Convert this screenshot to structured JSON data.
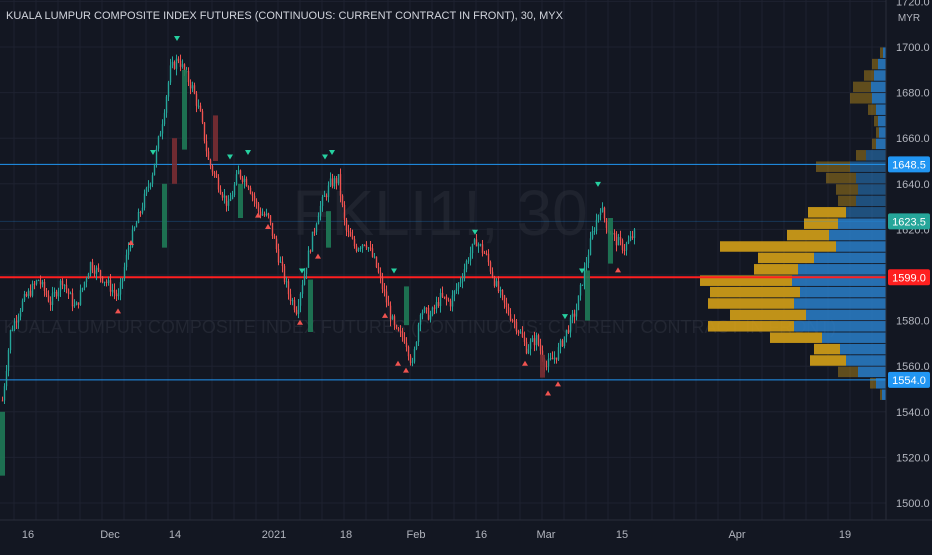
{
  "header": {
    "title": "KUALA LUMPUR COMPOSITE INDEX FUTURES (CONTINUOUS: CURRENT CONTRACT IN FRONT), 30, MYX"
  },
  "watermark": {
    "symbol": "FKLI1!, 30",
    "description": "KUALA LUMPUR COMPOSITE INDEX FUTURES (CONTINUOUS: CURRENT CONTRACT IN FRONT)"
  },
  "colors": {
    "background": "#131722",
    "grid": "#1e2230",
    "up": "#26a69a",
    "down": "#ef5350",
    "vol_up": "#2a7fc9",
    "vol_down": "#d4a017",
    "hline_blue": "#2196f3",
    "hline_red": "#ff1f1f",
    "badge_teal": "#26a69a",
    "text": "#b2b5be"
  },
  "chart_data": {
    "type": "candlestick",
    "currency": "MYR",
    "ylim": [
      1495,
      1720
    ],
    "y_ticks": [
      1500,
      1520,
      1540,
      1560,
      1580,
      1600,
      1620,
      1640,
      1660,
      1680,
      1700,
      1720
    ],
    "x_ticks": [
      {
        "label": "16",
        "pos": 28
      },
      {
        "label": "Dec",
        "pos": 110
      },
      {
        "label": "14",
        "pos": 175
      },
      {
        "label": "2021",
        "pos": 274
      },
      {
        "label": "18",
        "pos": 346
      },
      {
        "label": "Feb",
        "pos": 416
      },
      {
        "label": "16",
        "pos": 481
      },
      {
        "label": "Mar",
        "pos": 546
      },
      {
        "label": "15",
        "pos": 622
      },
      {
        "label": "Apr",
        "pos": 737
      },
      {
        "label": "19",
        "pos": 845
      }
    ],
    "price_path": [
      [
        2,
        1545
      ],
      [
        10,
        1575
      ],
      [
        22,
        1588
      ],
      [
        38,
        1598
      ],
      [
        50,
        1588
      ],
      [
        62,
        1598
      ],
      [
        75,
        1585
      ],
      [
        90,
        1605
      ],
      [
        104,
        1598
      ],
      [
        118,
        1590
      ],
      [
        128,
        1612
      ],
      [
        140,
        1628
      ],
      [
        152,
        1645
      ],
      [
        162,
        1668
      ],
      [
        170,
        1690
      ],
      [
        178,
        1695
      ],
      [
        185,
        1688
      ],
      [
        192,
        1682
      ],
      [
        200,
        1670
      ],
      [
        208,
        1650
      ],
      [
        218,
        1640
      ],
      [
        228,
        1630
      ],
      [
        238,
        1645
      ],
      [
        248,
        1640
      ],
      [
        258,
        1628
      ],
      [
        268,
        1625
      ],
      [
        278,
        1608
      ],
      [
        288,
        1592
      ],
      [
        296,
        1585
      ],
      [
        306,
        1605
      ],
      [
        318,
        1628
      ],
      [
        330,
        1640
      ],
      [
        338,
        1642
      ],
      [
        345,
        1620
      ],
      [
        355,
        1612
      ],
      [
        365,
        1615
      ],
      [
        375,
        1605
      ],
      [
        385,
        1590
      ],
      [
        395,
        1575
      ],
      [
        405,
        1572
      ],
      [
        412,
        1560
      ],
      [
        420,
        1585
      ],
      [
        430,
        1582
      ],
      [
        440,
        1590
      ],
      [
        450,
        1588
      ],
      [
        460,
        1598
      ],
      [
        468,
        1608
      ],
      [
        476,
        1615
      ],
      [
        486,
        1608
      ],
      [
        496,
        1595
      ],
      [
        506,
        1585
      ],
      [
        516,
        1578
      ],
      [
        526,
        1568
      ],
      [
        536,
        1572
      ],
      [
        546,
        1560
      ],
      [
        556,
        1565
      ],
      [
        566,
        1575
      ],
      [
        576,
        1585
      ],
      [
        584,
        1602
      ],
      [
        592,
        1618
      ],
      [
        600,
        1630
      ],
      [
        608,
        1620
      ],
      [
        616,
        1615
      ],
      [
        624,
        1612
      ],
      [
        634,
        1618
      ]
    ],
    "horizontal_lines": [
      {
        "price": 1648.5,
        "label": "1648.5",
        "color": "#2196f3",
        "badge": "#2196f3",
        "width": 1
      },
      {
        "price": 1623.5,
        "label": "1623.5",
        "color": "#2196f3",
        "badge": "#26a69a",
        "width": 0,
        "faint": true
      },
      {
        "price": 1599.0,
        "label": "1599.0",
        "color": "#ff1f1f",
        "badge": "#ff1f1f",
        "width": 2
      },
      {
        "price": 1554.0,
        "label": "1554.0",
        "color": "#2196f3",
        "badge": "#2196f3",
        "width": 1
      }
    ],
    "signals_up": [
      [
        118,
        1588
      ],
      [
        131,
        1618
      ],
      [
        258,
        1630
      ],
      [
        268,
        1625
      ],
      [
        300,
        1583
      ],
      [
        318,
        1612
      ],
      [
        385,
        1586
      ],
      [
        398,
        1565
      ],
      [
        406,
        1562
      ],
      [
        525,
        1565
      ],
      [
        548,
        1552
      ],
      [
        558,
        1556
      ],
      [
        618,
        1606
      ]
    ],
    "signals_down": [
      [
        153,
        1650
      ],
      [
        177,
        1700
      ],
      [
        230,
        1648
      ],
      [
        248,
        1650
      ],
      [
        302,
        1598
      ],
      [
        325,
        1648
      ],
      [
        332,
        1650
      ],
      [
        394,
        1598
      ],
      [
        475,
        1615
      ],
      [
        565,
        1578
      ],
      [
        582,
        1598
      ],
      [
        598,
        1636
      ]
    ],
    "volume_profile": {
      "x_right": 886,
      "rows": [
        {
          "price": 1697.5,
          "up": 3,
          "down": 3
        },
        {
          "price": 1692.5,
          "up": 8,
          "down": 6
        },
        {
          "price": 1687.5,
          "up": 12,
          "down": 10
        },
        {
          "price": 1682.5,
          "up": 15,
          "down": 18
        },
        {
          "price": 1677.5,
          "up": 14,
          "down": 22
        },
        {
          "price": 1672.5,
          "up": 10,
          "down": 8
        },
        {
          "price": 1667.5,
          "up": 8,
          "down": 4
        },
        {
          "price": 1662.5,
          "up": 7,
          "down": 3
        },
        {
          "price": 1657.5,
          "up": 10,
          "down": 4
        },
        {
          "price": 1652.5,
          "up": 20,
          "down": 10
        },
        {
          "price": 1647.5,
          "up": 36,
          "down": 34
        },
        {
          "price": 1642.5,
          "up": 30,
          "down": 30
        },
        {
          "price": 1637.5,
          "up": 28,
          "down": 22
        },
        {
          "price": 1632.5,
          "up": 30,
          "down": 18
        },
        {
          "price": 1627.5,
          "up": 40,
          "down": 38
        },
        {
          "price": 1622.5,
          "up": 48,
          "down": 34
        },
        {
          "price": 1617.5,
          "up": 57,
          "down": 42
        },
        {
          "price": 1612.5,
          "up": 50,
          "down": 116
        },
        {
          "price": 1607.5,
          "up": 72,
          "down": 56
        },
        {
          "price": 1602.5,
          "up": 88,
          "down": 44
        },
        {
          "price": 1597.5,
          "up": 94,
          "down": 92
        },
        {
          "price": 1592.5,
          "up": 86,
          "down": 90
        },
        {
          "price": 1587.5,
          "up": 92,
          "down": 86
        },
        {
          "price": 1582.5,
          "up": 80,
          "down": 76
        },
        {
          "price": 1577.5,
          "up": 92,
          "down": 86
        },
        {
          "price": 1572.5,
          "up": 64,
          "down": 52
        },
        {
          "price": 1567.5,
          "up": 46,
          "down": 26
        },
        {
          "price": 1562.5,
          "up": 40,
          "down": 36
        },
        {
          "price": 1557.5,
          "up": 28,
          "down": 20
        },
        {
          "price": 1552.5,
          "up": 10,
          "down": 6
        },
        {
          "price": 1547.5,
          "up": 4,
          "down": 2
        }
      ]
    }
  }
}
